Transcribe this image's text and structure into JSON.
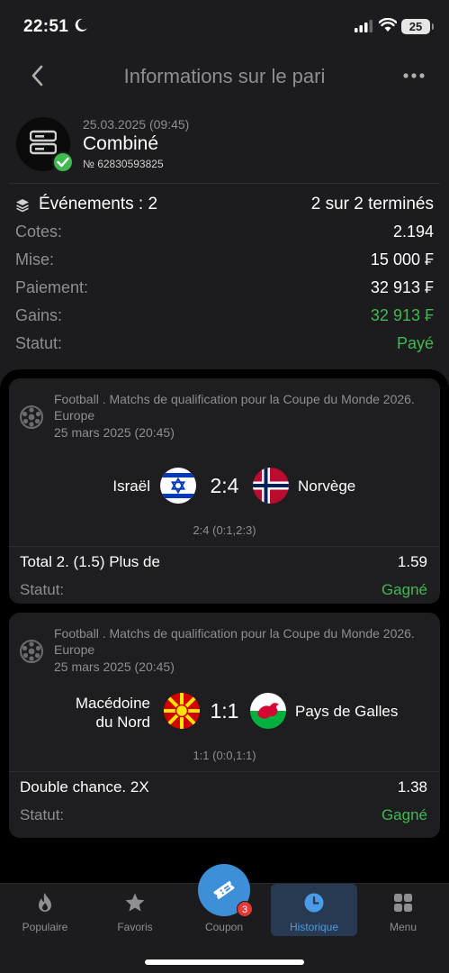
{
  "status_bar": {
    "time": "22:51",
    "battery": "25"
  },
  "header": {
    "title": "Informations sur le pari"
  },
  "bet": {
    "date": "25.03.2025 (09:45)",
    "type": "Combiné",
    "number": "№ 62830593825"
  },
  "summary": {
    "events_label": "Événements : 2",
    "events_value": "2 sur 2 terminés",
    "rows": [
      {
        "label": "Cotes:",
        "value": "2.194"
      },
      {
        "label": "Mise:",
        "value": "15 000 ₣"
      },
      {
        "label": "Paiement:",
        "value": "32 913 ₣"
      },
      {
        "label": "Gains:",
        "value": "32 913 ₣"
      },
      {
        "label": "Statut:",
        "value": "Payé"
      }
    ]
  },
  "events": [
    {
      "league": "Football . Matchs de qualification pour la Coupe du Monde 2026. Europe",
      "date": "25 mars 2025 (20:45)",
      "home": "Israël",
      "away": "Norvège",
      "score": "2:4",
      "detail": "2:4 (0:1,2:3)",
      "pick": "Total 2. (1.5) Plus de",
      "odd": "1.59",
      "status_label": "Statut:",
      "status": "Gagné"
    },
    {
      "league": "Football . Matchs de qualification pour la Coupe du Monde 2026. Europe",
      "date": "25 mars 2025 (20:45)",
      "home_line1": "Macédoine",
      "home_line2": "du Nord",
      "away": "Pays de Galles",
      "score": "1:1",
      "detail": "1:1 (0:0,1:1)",
      "pick": "Double chance. 2X",
      "odd": "1.38",
      "status_label": "Statut:",
      "status": "Gagné"
    }
  ],
  "tabbar": {
    "items": [
      {
        "label": "Populaire",
        "icon": "fire-icon"
      },
      {
        "label": "Favoris",
        "icon": "star-icon"
      },
      {
        "label": "Coupon",
        "icon": "ticket-icon",
        "badge": "3"
      },
      {
        "label": "Historique",
        "icon": "clock-icon",
        "active": true
      },
      {
        "label": "Menu",
        "icon": "grid-icon"
      }
    ]
  },
  "colors": {
    "background": "#1c1c1e",
    "accent_green": "#3fb950",
    "accent_blue": "#3d8fd8",
    "muted": "#8e8e93"
  }
}
